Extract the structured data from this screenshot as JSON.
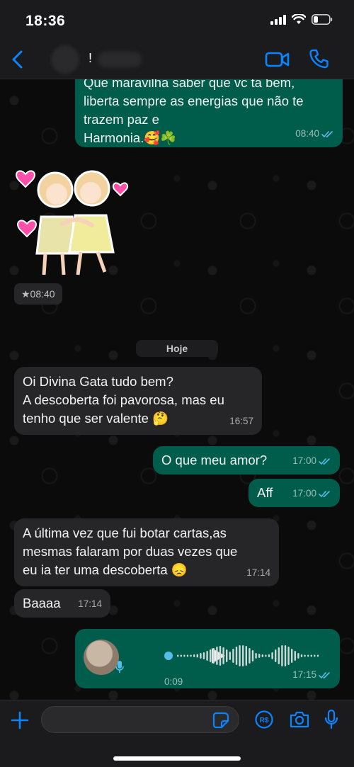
{
  "status_bar": {
    "time": "18:36"
  },
  "header": {
    "contact_name": "!"
  },
  "messages": [
    {
      "id": "m1",
      "direction": "out",
      "text": "Que maravilha saber que vc tá bem,\nliberta sempre as energias que não te\ntrazem paz e\nHarmonia.🥰☘️",
      "time": "08:40",
      "read": true
    },
    {
      "id": "m2",
      "direction": "in",
      "type": "sticker",
      "time": "★08:40"
    },
    {
      "id": "m3",
      "direction": "in",
      "text": "Oi Divina Gata tudo bem?\nA descoberta foi pavorosa, mas eu\ntenho que ser valente 🤔",
      "time": "16:57"
    },
    {
      "id": "m4",
      "direction": "out",
      "text": "O que meu amor?",
      "time": "17:00",
      "read": true
    },
    {
      "id": "m5",
      "direction": "out",
      "text": "Aff",
      "time": "17:00",
      "read": true
    },
    {
      "id": "m6",
      "direction": "in",
      "text": "A última vez que fui botar cartas,as\nmesmas falaram por duas vezes que\neu ia ter uma descoberta 😞",
      "time": "17:14"
    },
    {
      "id": "m7",
      "direction": "in",
      "text": "Baaaa",
      "time": "17:14"
    },
    {
      "id": "m8",
      "direction": "out",
      "type": "voice",
      "duration": "0:09",
      "time": "17:15",
      "read": true
    }
  ],
  "date_divider": "Hoje",
  "input": {
    "placeholder": ""
  },
  "colors": {
    "outgoing": "#005c4b",
    "incoming": "#262628",
    "accent": "#0a84ff",
    "read_ticks": "#53bdeb"
  }
}
